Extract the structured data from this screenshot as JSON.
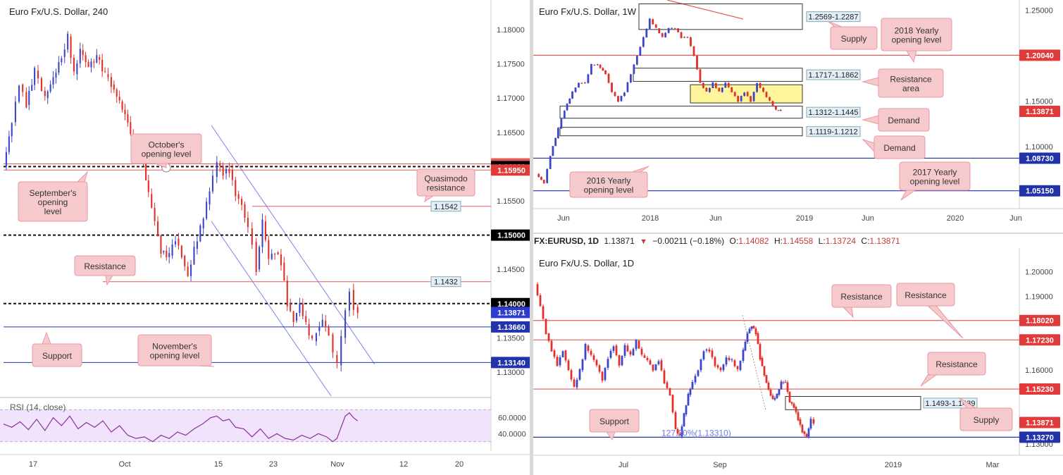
{
  "colors": {
    "bull": "#3b46c8",
    "bear": "#e0302b",
    "res": "#e55b5b",
    "sup": "#2233aa",
    "callout_bg": "#f6c9cd",
    "callout_border": "#e59aa2",
    "rsi": "#8b2f9e",
    "rsi_bg": "#f1e3fb",
    "zone": "#fff59a"
  },
  "ticker": {
    "symbol": "FX:EURUSD, 1D",
    "last": "1.13871",
    "arrow_icon": "down-triangle-icon",
    "change": "−0.00211 (−0.18%)",
    "o_label": "O:",
    "o": "1.14082",
    "h_label": "H:",
    "h": "1.14558",
    "l_label": "L:",
    "l": "1.13724",
    "c_label": "C:",
    "c": "1.13871"
  },
  "chart_data": [
    {
      "type": "line",
      "title": "Euro Fx/U.S. Dollar, 240",
      "timeframe": "240",
      "ylim": [
        1.1265,
        1.1835
      ],
      "y_ticks": [
        "1.18000",
        "1.17500",
        "1.17000",
        "1.16500",
        "1.15500",
        "1.14500",
        "1.13500",
        "1.13000"
      ],
      "x_ticks": [
        "17",
        "Oct",
        "15",
        "23",
        "Nov",
        "12",
        "20"
      ],
      "close_path": [
        [
          0,
          1.16
        ],
        [
          8,
          1.1665
        ],
        [
          15,
          1.172
        ],
        [
          22,
          1.169
        ],
        [
          30,
          1.174
        ],
        [
          40,
          1.17
        ],
        [
          48,
          1.173
        ],
        [
          56,
          1.176
        ],
        [
          62,
          1.179
        ],
        [
          68,
          1.1735
        ],
        [
          74,
          1.177
        ],
        [
          82,
          1.1745
        ],
        [
          90,
          1.176
        ],
        [
          98,
          1.1735
        ],
        [
          104,
          1.172
        ],
        [
          112,
          1.1695
        ],
        [
          120,
          1.1665
        ],
        [
          128,
          1.1625
        ],
        [
          135,
          1.1605
        ],
        [
          140,
          1.156
        ],
        [
          146,
          1.152
        ],
        [
          152,
          1.1475
        ],
        [
          160,
          1.147
        ],
        [
          166,
          1.1495
        ],
        [
          172,
          1.147
        ],
        [
          178,
          1.144
        ],
        [
          184,
          1.148
        ],
        [
          190,
          1.151
        ],
        [
          196,
          1.1545
        ],
        [
          202,
          1.1585
        ],
        [
          206,
          1.1605
        ],
        [
          212,
          1.159
        ],
        [
          218,
          1.1595
        ],
        [
          224,
          1.156
        ],
        [
          230,
          1.1545
        ],
        [
          236,
          1.151
        ],
        [
          240,
          1.149
        ],
        [
          244,
          1.145
        ],
        [
          250,
          1.152
        ],
        [
          256,
          1.1465
        ],
        [
          262,
          1.1475
        ],
        [
          268,
          1.146
        ],
        [
          274,
          1.14
        ],
        [
          280,
          1.1375
        ],
        [
          286,
          1.14
        ],
        [
          292,
          1.137
        ],
        [
          298,
          1.1345
        ],
        [
          302,
          1.136
        ],
        [
          308,
          1.1375
        ],
        [
          314,
          1.1355
        ],
        [
          318,
          1.1325
        ],
        [
          322,
          1.131
        ],
        [
          326,
          1.135
        ],
        [
          330,
          1.139
        ],
        [
          334,
          1.142
        ],
        [
          338,
          1.1395
        ],
        [
          342,
          1.139
        ]
      ],
      "levels": [
        {
          "name": "September's opening level / 1.1604",
          "value": 1.1604,
          "label": "1.16040",
          "color": "#e55b5b"
        },
        {
          "name": "1.1600 round",
          "value": 1.16,
          "label": "1.16000",
          "color": "#111111"
        },
        {
          "name": "Quasimodo resistance",
          "value": 1.1595,
          "label": "1.15950",
          "color": "#e55b5b"
        },
        {
          "name": "1.1542",
          "value": 1.1542,
          "label": "1.1542",
          "color": "#e55b5b"
        },
        {
          "name": "1.1500 round",
          "value": 1.15,
          "label": "1.15000",
          "color": "#111111"
        },
        {
          "name": "Resistance",
          "value": 1.1432,
          "label": "1.1432",
          "color": "#e55b5b"
        },
        {
          "name": "1.1400 round",
          "value": 1.14,
          "label": "1.14000",
          "color": "#111111"
        },
        {
          "name": "last price",
          "value": 1.13871,
          "label": "1.13871",
          "color": "#2233cc"
        },
        {
          "name": "Support",
          "value": 1.1366,
          "label": "1.13660",
          "color": "#2233aa"
        },
        {
          "name": "November's opening level",
          "value": 1.1314,
          "label": "1.13140",
          "color": "#2233aa"
        }
      ],
      "annotations": [
        "October's opening level",
        "September's opening level",
        "Quasimodo resistance",
        "Resistance",
        "Support",
        "November's opening level"
      ],
      "rsi": {
        "title": "RSI (14, close)",
        "levels": [
          30,
          70
        ],
        "y_ticks": [
          "60.0000",
          "40.0000"
        ],
        "values": [
          [
            0,
            52
          ],
          [
            8,
            48
          ],
          [
            16,
            55
          ],
          [
            24,
            45
          ],
          [
            32,
            58
          ],
          [
            40,
            44
          ],
          [
            48,
            60
          ],
          [
            56,
            50
          ],
          [
            64,
            62
          ],
          [
            72,
            46
          ],
          [
            80,
            54
          ],
          [
            88,
            48
          ],
          [
            96,
            56
          ],
          [
            104,
            42
          ],
          [
            112,
            50
          ],
          [
            120,
            38
          ],
          [
            128,
            34
          ],
          [
            136,
            36
          ],
          [
            144,
            30
          ],
          [
            152,
            38
          ],
          [
            160,
            34
          ],
          [
            168,
            42
          ],
          [
            176,
            38
          ],
          [
            184,
            46
          ],
          [
            192,
            52
          ],
          [
            200,
            60
          ],
          [
            206,
            62
          ],
          [
            212,
            56
          ],
          [
            218,
            58
          ],
          [
            224,
            48
          ],
          [
            232,
            46
          ],
          [
            240,
            36
          ],
          [
            248,
            46
          ],
          [
            256,
            34
          ],
          [
            264,
            40
          ],
          [
            272,
            34
          ],
          [
            280,
            32
          ],
          [
            288,
            38
          ],
          [
            296,
            34
          ],
          [
            304,
            40
          ],
          [
            312,
            36
          ],
          [
            318,
            30
          ],
          [
            322,
            34
          ],
          [
            326,
            48
          ],
          [
            330,
            62
          ],
          [
            334,
            66
          ],
          [
            338,
            60
          ],
          [
            342,
            56
          ]
        ]
      },
      "channel": {
        "label": "descending channel"
      }
    },
    {
      "type": "line",
      "title": "Euro Fx/U.S. Dollar, 1W",
      "timeframe": "1W",
      "ylim": [
        1.035,
        1.258
      ],
      "y_ticks": [
        "1.25000",
        "1.15000",
        "1.10000"
      ],
      "x_ticks": [
        "Jun",
        "2018",
        "Jun",
        "2019",
        "Jun",
        "2020",
        "Jun"
      ],
      "close_path": [
        [
          0,
          1.07
        ],
        [
          10,
          1.06
        ],
        [
          18,
          1.09
        ],
        [
          28,
          1.12
        ],
        [
          36,
          1.14
        ],
        [
          46,
          1.16
        ],
        [
          54,
          1.17
        ],
        [
          62,
          1.17
        ],
        [
          70,
          1.19
        ],
        [
          78,
          1.19
        ],
        [
          88,
          1.18
        ],
        [
          96,
          1.16
        ],
        [
          104,
          1.15
        ],
        [
          112,
          1.16
        ],
        [
          120,
          1.18
        ],
        [
          128,
          1.2
        ],
        [
          136,
          1.22
        ],
        [
          144,
          1.24
        ],
        [
          152,
          1.23
        ],
        [
          160,
          1.22
        ],
        [
          168,
          1.23
        ],
        [
          176,
          1.23
        ],
        [
          184,
          1.22
        ],
        [
          192,
          1.22
        ],
        [
          200,
          1.2
        ],
        [
          208,
          1.17
        ],
        [
          216,
          1.16
        ],
        [
          224,
          1.17
        ],
        [
          232,
          1.16
        ],
        [
          240,
          1.17
        ],
        [
          248,
          1.16
        ],
        [
          256,
          1.15
        ],
        [
          264,
          1.16
        ],
        [
          272,
          1.15
        ],
        [
          280,
          1.17
        ],
        [
          288,
          1.16
        ],
        [
          296,
          1.15
        ],
        [
          304,
          1.14
        ],
        [
          310,
          1.14
        ]
      ],
      "zones": [
        {
          "name": "Supply",
          "range": "1.2569-1.2287",
          "low": 1.2287,
          "high": 1.2569
        },
        {
          "name": "Resistance area",
          "range": "1.1717-1.1862",
          "low": 1.1717,
          "high": 1.1862
        },
        {
          "name": "Demand",
          "range": "1.1312-1.1445",
          "low": 1.1312,
          "high": 1.1445
        },
        {
          "name": "Demand",
          "range": "1.1119-1.1212",
          "low": 1.1119,
          "high": 1.1212
        }
      ],
      "highlight": {
        "low": 1.148,
        "high": 1.168
      },
      "levels": [
        {
          "name": "2018 Yearly opening level",
          "value": 1.2004,
          "label": "1.20040",
          "color": "#e55b5b"
        },
        {
          "name": "last price",
          "value": 1.13871,
          "label": "1.13871",
          "color": "#e55b5b"
        },
        {
          "name": "2016 Yearly opening level",
          "value": 1.0873,
          "label": "1.08730",
          "color": "#2233aa"
        },
        {
          "name": "2017 Yearly opening level",
          "value": 1.0515,
          "label": "1.05150",
          "color": "#2233aa"
        }
      ],
      "annotations": [
        "Supply",
        "2018 Yearly opening level",
        "Resistance area",
        "Demand",
        "Demand",
        "2016 Yearly opening level",
        "2017 Yearly opening level"
      ]
    },
    {
      "type": "line",
      "title": "Euro Fx/U.S. Dollar, 1D",
      "timeframe": "1D",
      "ylim": [
        1.1288,
        1.2045
      ],
      "y_ticks": [
        "1.20000",
        "1.19000",
        "1.16000",
        "1.14000",
        "1.13000"
      ],
      "x_ticks": [
        "Jul",
        "Sep",
        "2019",
        "Mar"
      ],
      "close_path": [
        [
          0,
          1.195
        ],
        [
          8,
          1.186
        ],
        [
          16,
          1.175
        ],
        [
          24,
          1.168
        ],
        [
          32,
          1.162
        ],
        [
          40,
          1.168
        ],
        [
          48,
          1.16
        ],
        [
          56,
          1.153
        ],
        [
          64,
          1.16
        ],
        [
          72,
          1.17
        ],
        [
          80,
          1.166
        ],
        [
          88,
          1.162
        ],
        [
          96,
          1.156
        ],
        [
          104,
          1.165
        ],
        [
          112,
          1.17
        ],
        [
          120,
          1.162
        ],
        [
          128,
          1.17
        ],
        [
          136,
          1.166
        ],
        [
          144,
          1.172
        ],
        [
          152,
          1.166
        ],
        [
          160,
          1.164
        ],
        [
          168,
          1.16
        ],
        [
          176,
          1.164
        ],
        [
          184,
          1.155
        ],
        [
          192,
          1.15
        ],
        [
          200,
          1.136
        ],
        [
          206,
          1.133
        ],
        [
          212,
          1.142
        ],
        [
          218,
          1.15
        ],
        [
          224,
          1.155
        ],
        [
          232,
          1.16
        ],
        [
          240,
          1.168
        ],
        [
          248,
          1.168
        ],
        [
          256,
          1.162
        ],
        [
          264,
          1.16
        ],
        [
          272,
          1.165
        ],
        [
          280,
          1.164
        ],
        [
          288,
          1.16
        ],
        [
          296,
          1.168
        ],
        [
          302,
          1.175
        ],
        [
          308,
          1.178
        ],
        [
          314,
          1.175
        ],
        [
          320,
          1.165
        ],
        [
          326,
          1.158
        ],
        [
          332,
          1.152
        ],
        [
          338,
          1.148
        ],
        [
          344,
          1.15
        ],
        [
          350,
          1.155
        ],
        [
          356,
          1.155
        ],
        [
          362,
          1.147
        ],
        [
          368,
          1.145
        ],
        [
          374,
          1.14
        ],
        [
          380,
          1.135
        ],
        [
          386,
          1.133
        ],
        [
          392,
          1.14
        ],
        [
          396,
          1.1387
        ]
      ],
      "zones": [
        {
          "name": "Supply",
          "range": "1.1493-1.1439",
          "low": 1.1439,
          "high": 1.1493
        }
      ],
      "levels": [
        {
          "name": "Resistance 1.1802",
          "value": 1.1802,
          "label": "1.18020",
          "color": "#e55b5b"
        },
        {
          "name": "Resistance 1.1723",
          "value": 1.1723,
          "label": "1.17230",
          "color": "#e55b5b"
        },
        {
          "name": "Resistance 1.1523",
          "value": 1.1523,
          "label": "1.15230",
          "color": "#e55b5b"
        },
        {
          "name": "last price",
          "value": 1.13871,
          "label": "1.13871",
          "color": "#e55b5b"
        },
        {
          "name": "Support 1.1327",
          "value": 1.1327,
          "label": "1.13270",
          "color": "#2233aa"
        }
      ],
      "fib": "127.20%(1.13310)",
      "annotations": [
        "Resistance",
        "Resistance",
        "Resistance",
        "Supply",
        "Support"
      ]
    }
  ]
}
